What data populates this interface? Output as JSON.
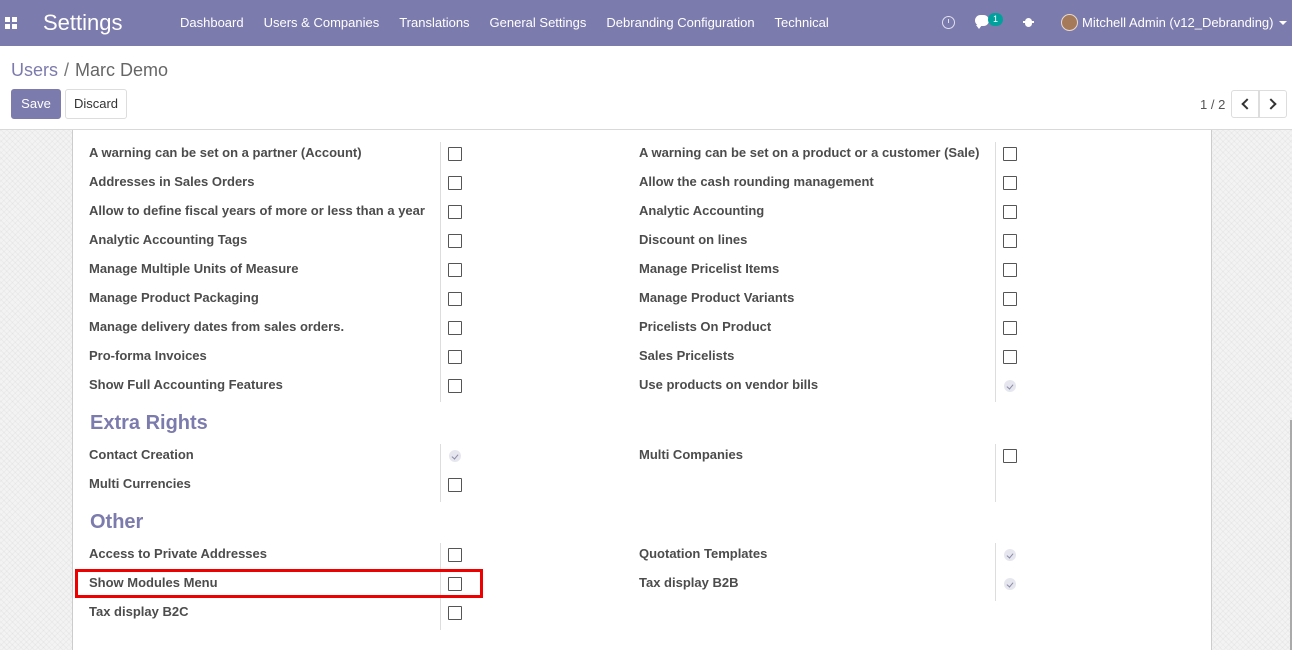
{
  "navbar": {
    "brand": "Settings",
    "menu": [
      "Dashboard",
      "Users & Companies",
      "Translations",
      "General Settings",
      "Debranding Configuration",
      "Technical"
    ],
    "chat_count": "1",
    "user": "Mitchell Admin (v12_Debranding)",
    "color": "#7c7bad"
  },
  "control_panel": {
    "breadcrumb": {
      "parent": "Users",
      "current": "Marc Demo"
    },
    "save_label": "Save",
    "discard_label": "Discard",
    "pager": "1 / 2"
  },
  "sections": {
    "extra_rights": "Extra Rights",
    "other": "Other"
  },
  "technical_settings": {
    "left": [
      {
        "label": "A warning can be set on a partner (Account)",
        "checked": false
      },
      {
        "label": "Addresses in Sales Orders",
        "checked": false
      },
      {
        "label": "Allow to define fiscal years of more or less than a year",
        "checked": false
      },
      {
        "label": "Analytic Accounting Tags",
        "checked": false
      },
      {
        "label": "Manage Multiple Units of Measure",
        "checked": false
      },
      {
        "label": "Manage Product Packaging",
        "checked": false
      },
      {
        "label": "Manage delivery dates from sales orders.",
        "checked": false
      },
      {
        "label": "Pro-forma Invoices",
        "checked": false
      },
      {
        "label": "Show Full Accounting Features",
        "checked": false
      }
    ],
    "right": [
      {
        "label": "A warning can be set on a product or a customer (Sale)",
        "checked": false
      },
      {
        "label": "Allow the cash rounding management",
        "checked": false
      },
      {
        "label": "Analytic Accounting",
        "checked": false
      },
      {
        "label": "Discount on lines",
        "checked": false
      },
      {
        "label": "Manage Pricelist Items",
        "checked": false
      },
      {
        "label": "Manage Product Variants",
        "checked": false
      },
      {
        "label": "Pricelists On Product",
        "checked": false
      },
      {
        "label": "Sales Pricelists",
        "checked": false
      },
      {
        "label": "Use products on vendor bills",
        "checked": true
      }
    ]
  },
  "extra_rights": {
    "left": [
      {
        "label": "Contact Creation",
        "checked": true
      },
      {
        "label": "Multi Currencies",
        "checked": false
      }
    ],
    "right": [
      {
        "label": "Multi Companies",
        "checked": false
      }
    ]
  },
  "other": {
    "left": [
      {
        "label": "Access to Private Addresses",
        "checked": false
      },
      {
        "label": "Show Modules Menu",
        "checked": false
      },
      {
        "label": "Tax display B2C",
        "checked": false
      }
    ],
    "right": [
      {
        "label": "Quotation Templates",
        "checked": true
      },
      {
        "label": "Tax display B2B",
        "checked": true
      }
    ]
  },
  "highlight_color": "#e00000"
}
